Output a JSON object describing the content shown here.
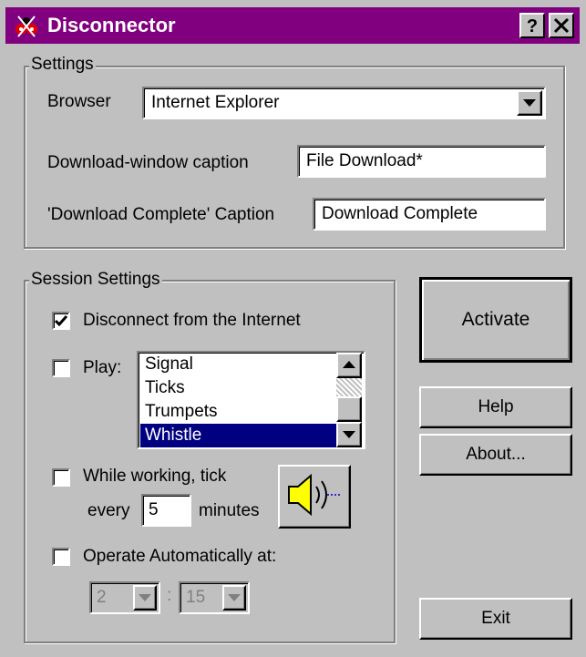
{
  "window": {
    "title": "Disconnector",
    "help_button": "?",
    "close_button": "✕"
  },
  "settings": {
    "legend": "Settings",
    "browser_label": "Browser",
    "browser_value": "Internet Explorer",
    "download_caption_label": "Download-window caption",
    "download_caption_value": "File Download*",
    "complete_caption_label": "'Download Complete' Caption",
    "complete_caption_value": "Download Complete"
  },
  "session": {
    "legend": "Session Settings",
    "disconnect_label": "Disconnect from the Internet",
    "disconnect_checked": true,
    "play_label": "Play:",
    "play_checked": false,
    "sounds": [
      "Signal",
      "Ticks",
      "Trumpets",
      "Whistle"
    ],
    "selected_sound": "Whistle",
    "tick_label_line1": "While working, tick",
    "tick_label_every": "every",
    "tick_minutes_value": "5",
    "tick_label_minutes": "minutes",
    "tick_checked": false,
    "auto_label": "Operate Automatically at:",
    "auto_checked": false,
    "auto_hour": "2",
    "auto_separator": ":",
    "auto_minute": "15"
  },
  "buttons": {
    "activate": "Activate",
    "help": "Help",
    "about": "About...",
    "exit": "Exit"
  },
  "colors": {
    "titlebar": "#800080",
    "face": "#c0c0c0",
    "selection": "#000080"
  }
}
